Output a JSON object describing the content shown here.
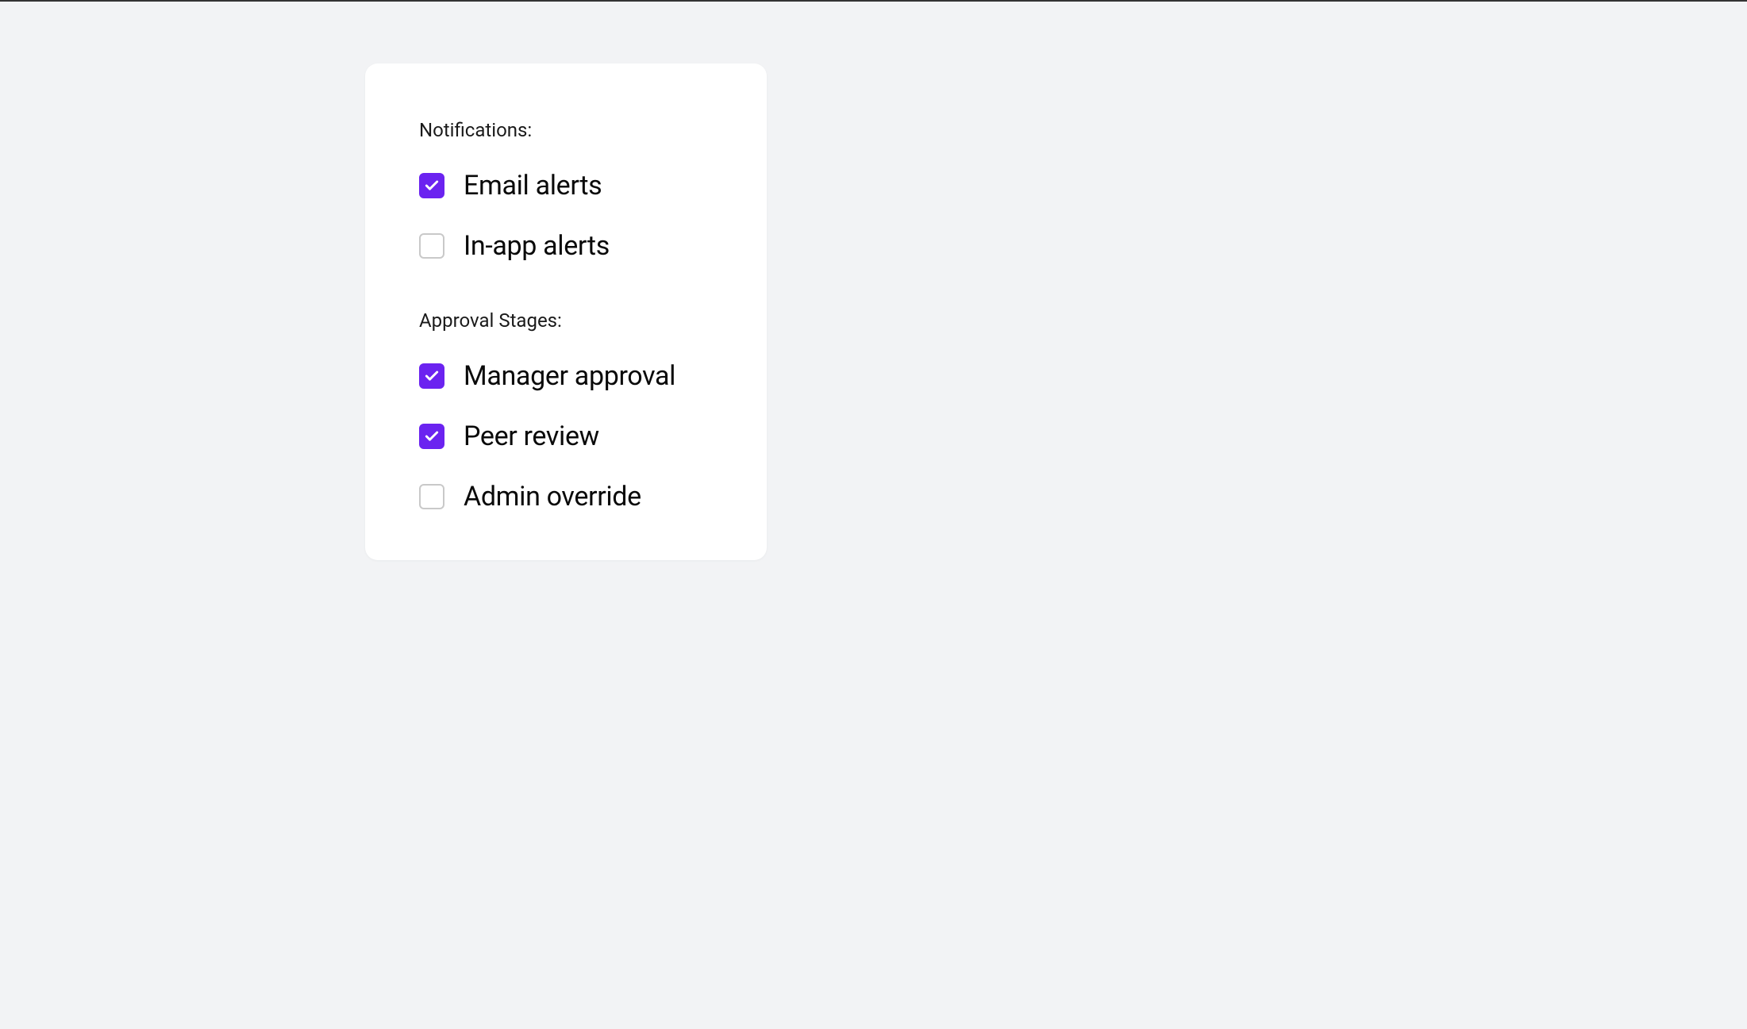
{
  "colors": {
    "accent": "#6b23f0",
    "background": "#f2f3f5",
    "card": "#ffffff",
    "text": "#0a0a0a",
    "checkbox_border": "#c9c9c9"
  },
  "groups": [
    {
      "title": "Notifications:",
      "options": [
        {
          "label": "Email alerts",
          "checked": true
        },
        {
          "label": "In-app alerts",
          "checked": false
        }
      ]
    },
    {
      "title": "Approval Stages:",
      "options": [
        {
          "label": "Manager approval",
          "checked": true
        },
        {
          "label": "Peer review",
          "checked": true
        },
        {
          "label": "Admin override",
          "checked": false
        }
      ]
    }
  ]
}
